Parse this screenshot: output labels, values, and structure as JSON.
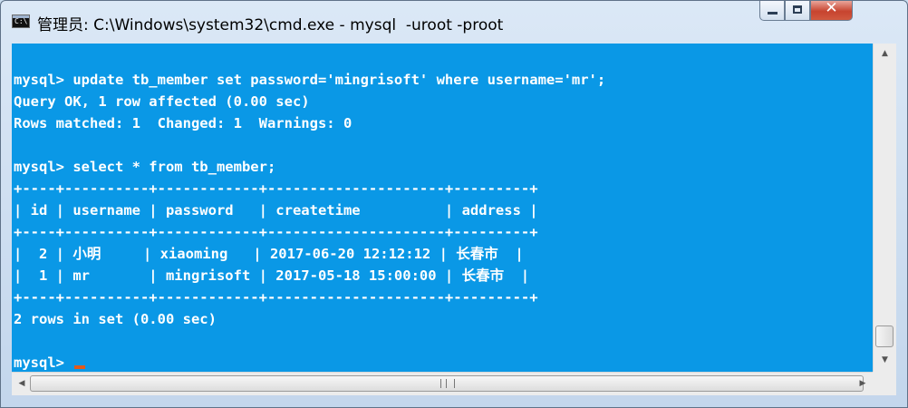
{
  "window": {
    "title": "管理员: C:\\Windows\\system32\\cmd.exe - mysql  -uroot -proot",
    "icon": "cmd-icon"
  },
  "console": {
    "lines": [
      "mysql> update tb_member set password='mingrisoft' where username='mr';",
      "Query OK, 1 row affected (0.00 sec)",
      "Rows matched: 1  Changed: 1  Warnings: 0",
      "",
      "mysql> select * from tb_member;",
      "+----+----------+------------+---------------------+---------+",
      "| id | username | password   | createtime          | address |",
      "+----+----------+------------+---------------------+---------+",
      "|  2 | 小明     | xiaoming   | 2017-06-20 12:12:12 | 长春市  |",
      "|  1 | mr       | mingrisoft | 2017-05-18 15:00:00 | 长春市  |",
      "+----+----------+------------+---------------------+---------+",
      "2 rows in set (0.00 sec)",
      "",
      "mysql> "
    ],
    "cursor_color": "#e05a1c",
    "background": "#0a98e6",
    "text_color": "#ffffff"
  }
}
